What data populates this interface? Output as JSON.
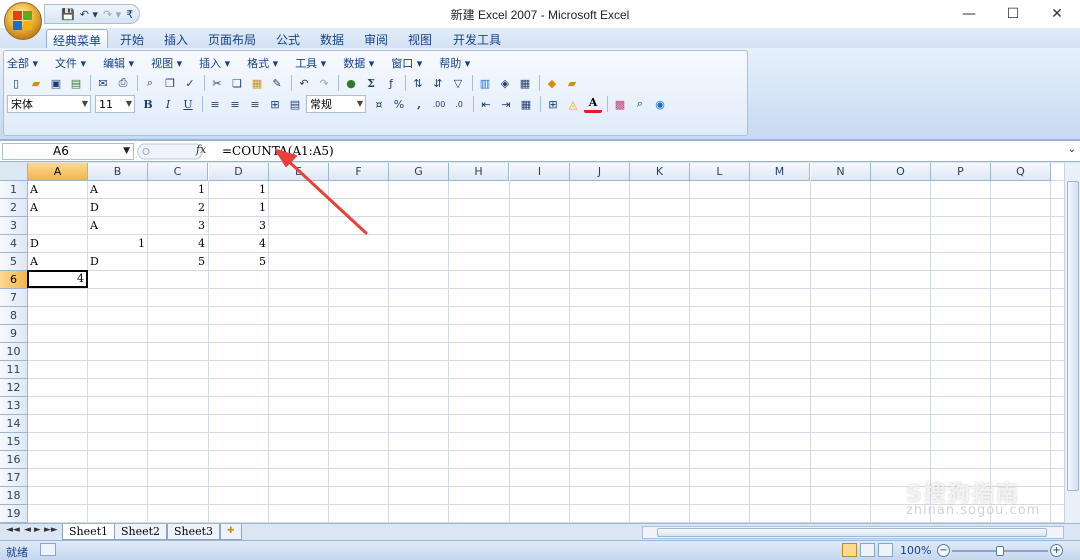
{
  "window": {
    "title": "新建 Excel 2007 - Microsoft Excel",
    "minimize": "—",
    "maximize": "☐",
    "close": "✕"
  },
  "qat": {
    "save": "💾",
    "undo": "↶ ▾",
    "redo": "↷ ▾",
    "customize": "₹"
  },
  "ribbon_tabs": [
    "经典菜单",
    "开始",
    "插入",
    "页面布局",
    "公式",
    "数据",
    "审阅",
    "视图",
    "开发工具"
  ],
  "ribbon_right": {
    "help": "◉",
    "minimize": "–",
    "restore": "▫",
    "close": "x"
  },
  "classic_menu": [
    "全部 ▾",
    "文件 ▾",
    "编辑 ▾",
    "视图 ▾",
    "插入 ▾",
    "格式 ▾",
    "工具 ▾",
    "数据 ▾",
    "窗口 ▾",
    "帮助 ▾"
  ],
  "format": {
    "font": "宋体",
    "size": "11",
    "number_format": "常规",
    "bold": "B",
    "italic": "I",
    "underline": "U",
    "percent": "%",
    "comma": ",",
    "inc_dec": ".00",
    "dec_dec": ".0"
  },
  "formula_bar": {
    "name_box": "A6",
    "fx": "fx",
    "formula": "=COUNTA(A1:A5)",
    "expand": "⌄"
  },
  "columns": [
    "A",
    "B",
    "C",
    "D",
    "E",
    "F",
    "G",
    "H",
    "I",
    "J",
    "K",
    "L",
    "M",
    "N",
    "O",
    "P",
    "Q"
  ],
  "rows": [
    "1",
    "2",
    "3",
    "4",
    "5",
    "6",
    "7",
    "8",
    "9",
    "10",
    "11",
    "12",
    "13",
    "14",
    "15",
    "16",
    "17",
    "18",
    "19"
  ],
  "cells": [
    {
      "ref": "A1",
      "col": 0,
      "row": 0,
      "value": "A",
      "num": false
    },
    {
      "ref": "B1",
      "col": 1,
      "row": 0,
      "value": "A",
      "num": false
    },
    {
      "ref": "C1",
      "col": 2,
      "row": 0,
      "value": "1",
      "num": true
    },
    {
      "ref": "D1",
      "col": 3,
      "row": 0,
      "value": "1",
      "num": true
    },
    {
      "ref": "A2",
      "col": 0,
      "row": 1,
      "value": "A",
      "num": false
    },
    {
      "ref": "B2",
      "col": 1,
      "row": 1,
      "value": "D",
      "num": false
    },
    {
      "ref": "C2",
      "col": 2,
      "row": 1,
      "value": "2",
      "num": true
    },
    {
      "ref": "D2",
      "col": 3,
      "row": 1,
      "value": "1",
      "num": true
    },
    {
      "ref": "B3",
      "col": 1,
      "row": 2,
      "value": "A",
      "num": false
    },
    {
      "ref": "C3",
      "col": 2,
      "row": 2,
      "value": "3",
      "num": true
    },
    {
      "ref": "D3",
      "col": 3,
      "row": 2,
      "value": "3",
      "num": true
    },
    {
      "ref": "A4",
      "col": 0,
      "row": 3,
      "value": "D",
      "num": false
    },
    {
      "ref": "B4",
      "col": 1,
      "row": 3,
      "value": "1",
      "num": true
    },
    {
      "ref": "C4",
      "col": 2,
      "row": 3,
      "value": "4",
      "num": true
    },
    {
      "ref": "D4",
      "col": 3,
      "row": 3,
      "value": "4",
      "num": true
    },
    {
      "ref": "A5",
      "col": 0,
      "row": 4,
      "value": "A",
      "num": false
    },
    {
      "ref": "B5",
      "col": 1,
      "row": 4,
      "value": "D",
      "num": false
    },
    {
      "ref": "C5",
      "col": 2,
      "row": 4,
      "value": "5",
      "num": true
    },
    {
      "ref": "D5",
      "col": 3,
      "row": 4,
      "value": "5",
      "num": true
    },
    {
      "ref": "A6",
      "col": 0,
      "row": 5,
      "value": "4",
      "num": true,
      "active": true
    }
  ],
  "sheets": [
    "Sheet1",
    "Sheet2",
    "Sheet3"
  ],
  "sheet_nav": [
    "◄◄",
    "◄",
    "►",
    "►►"
  ],
  "status": {
    "ready": "就绪",
    "zoom": "100%",
    "zoom_out": "−",
    "zoom_in": "+"
  },
  "watermark": {
    "line1": "S搜狗指南",
    "line2": "zhinan.sogou.com"
  },
  "colors": {
    "accent": "#15428b",
    "selected_header": "#f1b44e",
    "annotation_arrow": "#e8403a"
  }
}
